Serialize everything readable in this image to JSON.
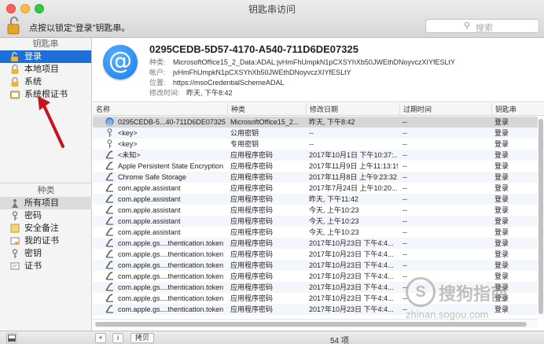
{
  "window": {
    "title": "钥匙串访问"
  },
  "toolbar": {
    "lock_text": "点按以锁定“登录”钥匙串。",
    "search_placeholder": "搜索"
  },
  "sidebar": {
    "keychains_header": "钥匙串",
    "keychains": [
      {
        "label": "登录",
        "icon": "keychain-open-icon",
        "selected": true
      },
      {
        "label": "本地项目",
        "icon": "keychain-icon",
        "selected": false
      },
      {
        "label": "系统",
        "icon": "lock-icon",
        "selected": false
      },
      {
        "label": "系统根证书",
        "icon": "folder-cert-icon",
        "selected": false
      }
    ],
    "category_header": "种类",
    "categories": [
      {
        "label": "所有项目",
        "icon": "all-items-icon",
        "selected": true
      },
      {
        "label": "密码",
        "icon": "password-icon",
        "selected": false
      },
      {
        "label": "安全备注",
        "icon": "secure-note-icon",
        "selected": false
      },
      {
        "label": "我的证书",
        "icon": "my-cert-icon",
        "selected": false
      },
      {
        "label": "密钥",
        "icon": "key-icon",
        "selected": false
      },
      {
        "label": "证书",
        "icon": "certificate-icon",
        "selected": false
      }
    ]
  },
  "detail": {
    "icon": "at-sign-icon",
    "title": "0295CEDB-5D57-4170-A540-711D6DE07325",
    "kind_label": "种类:",
    "kind_value": "MicrosoftOffice15_2_Data:ADAL:jvHmFhUmpkN1pCXSYhXb50JWEthDNoyvczXIYfESLtY",
    "account_label": "帐户:",
    "account_value": "jvHmFhUmpkN1pCXSYhXb50JWEthDNoyvczXIYfESLtY",
    "where_label": "位置:",
    "where_value": "https://msoCredentialSchemeADAL",
    "modified_label": "修改时间:",
    "modified_value": "昨天, 下午8:42"
  },
  "table": {
    "columns": [
      "名称",
      "种类",
      "修改日期",
      "过期时间",
      "钥匙串"
    ],
    "rows": [
      {
        "icon": "at-sign-icon",
        "name": "0295CEDB-5...40-711D6DE07325",
        "kind": "MicrosoftOffice15_2...",
        "modified": "昨天, 下午8:42",
        "expires": "--",
        "keychain": "登录"
      },
      {
        "icon": "key-icon",
        "name": "<key>",
        "kind": "公用密钥",
        "modified": "--",
        "expires": "--",
        "keychain": "登录"
      },
      {
        "icon": "key-icon",
        "name": "<key>",
        "kind": "专用密钥",
        "modified": "--",
        "expires": "--",
        "keychain": "登录"
      },
      {
        "icon": "password-icon",
        "name": "<未知>",
        "kind": "应用程序密码",
        "modified": "2017年10月1日 下午10:37:...",
        "expires": "--",
        "keychain": "登录"
      },
      {
        "icon": "password-icon",
        "name": "Apple Persistent State Encryption",
        "kind": "应用程序密码",
        "modified": "2017年11月9日 上午11:13:19",
        "expires": "--",
        "keychain": "登录"
      },
      {
        "icon": "password-icon",
        "name": "Chrome Safe Storage",
        "kind": "应用程序密码",
        "modified": "2017年11月8日 上午9:23:32",
        "expires": "--",
        "keychain": "登录"
      },
      {
        "icon": "password-icon",
        "name": "com.apple.assistant",
        "kind": "应用程序密码",
        "modified": "2017年7月24日 上午10:20...",
        "expires": "--",
        "keychain": "登录"
      },
      {
        "icon": "password-icon",
        "name": "com.apple.assistant",
        "kind": "应用程序密码",
        "modified": "昨天, 下午11:42",
        "expires": "--",
        "keychain": "登录"
      },
      {
        "icon": "password-icon",
        "name": "com.apple.assistant",
        "kind": "应用程序密码",
        "modified": "今天, 上午10:23",
        "expires": "--",
        "keychain": "登录"
      },
      {
        "icon": "password-icon",
        "name": "com.apple.assistant",
        "kind": "应用程序密码",
        "modified": "今天, 上午10:23",
        "expires": "--",
        "keychain": "登录"
      },
      {
        "icon": "password-icon",
        "name": "com.apple.assistant",
        "kind": "应用程序密码",
        "modified": "今天, 上午10:23",
        "expires": "--",
        "keychain": "登录"
      },
      {
        "icon": "password-icon",
        "name": "com.apple.gs....thentication.token",
        "kind": "应用程序密码",
        "modified": "2017年10月23日 下午4:4...",
        "expires": "--",
        "keychain": "登录"
      },
      {
        "icon": "password-icon",
        "name": "com.apple.gs....thentication.token",
        "kind": "应用程序密码",
        "modified": "2017年10月23日 下午4:4...",
        "expires": "--",
        "keychain": "登录"
      },
      {
        "icon": "password-icon",
        "name": "com.apple.gs....thentication.token",
        "kind": "应用程序密码",
        "modified": "2017年10月23日 下午4:4...",
        "expires": "--",
        "keychain": "登录"
      },
      {
        "icon": "password-icon",
        "name": "com.apple.gs....thentication.token",
        "kind": "应用程序密码",
        "modified": "2017年10月23日 下午4:4...",
        "expires": "--",
        "keychain": "登录"
      },
      {
        "icon": "password-icon",
        "name": "com.apple.gs....thentication.token",
        "kind": "应用程序密码",
        "modified": "2017年10月23日 下午4:4...",
        "expires": "--",
        "keychain": "登录"
      },
      {
        "icon": "password-icon",
        "name": "com.apple.gs....thentication.token",
        "kind": "应用程序密码",
        "modified": "2017年10月23日 下午4:4...",
        "expires": "--",
        "keychain": "登录"
      },
      {
        "icon": "password-icon",
        "name": "com.apple.gs....thentication.token",
        "kind": "应用程序密码",
        "modified": "2017年10月23日 下午4:4...",
        "expires": "--",
        "keychain": "登录"
      }
    ]
  },
  "footer": {
    "add_label": "+",
    "info_label": "i",
    "copy_label": "拷贝",
    "item_count": "54 项"
  },
  "watermark": {
    "main": "搜狗指南",
    "sub": "zhinan.sogou.com",
    "circle": "S"
  },
  "colors": {
    "selection": "#1e6ed8",
    "annotation_arrow": "#c8141e"
  }
}
